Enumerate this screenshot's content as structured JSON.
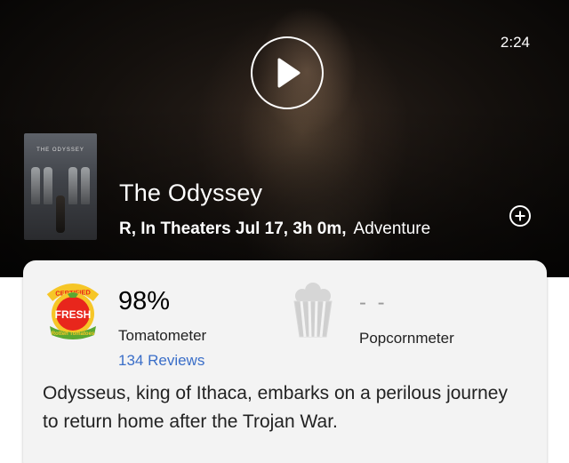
{
  "video": {
    "duration": "2:24",
    "play_icon": "play-icon"
  },
  "movie": {
    "poster_text": "THE ODYSSEY",
    "title": "The Odyssey",
    "rating_release": "R, In Theaters Jul 17, 3h 0m,",
    "genre": "Adventure",
    "add_icon": "add-circle-icon"
  },
  "scores": {
    "tomatometer": {
      "value": "98%",
      "label": "Tomatometer",
      "reviews": "134 Reviews",
      "badge": {
        "top_text": "CERTIFIED",
        "middle_text": "FRESH",
        "bottom_text": "Rotten Tomatoes",
        "icon": "certified-fresh-icon"
      }
    },
    "popcornmeter": {
      "value": "- -",
      "label": "Popcornmeter",
      "icon": "popcorn-bucket-icon"
    }
  },
  "synopsis": "Odysseus, king of Ithaca, embarks on a perilous journey to return home after the Trojan War.",
  "colors": {
    "link": "#3a6ec8",
    "badge_red": "#e8261c",
    "badge_yellow": "#f6c627",
    "badge_green": "#5aa832"
  }
}
